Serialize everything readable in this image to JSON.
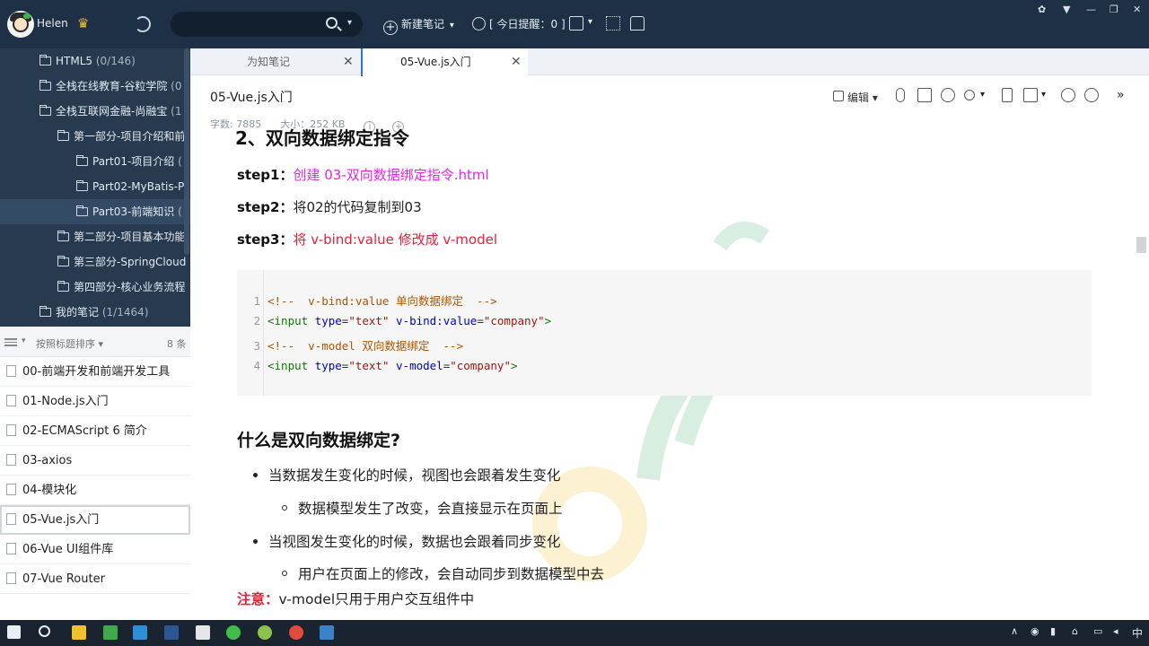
{
  "topbar": {
    "username": "Helen",
    "search_placeholder": "",
    "new_note": "新建笔记",
    "reminder": "[ 今日提醒：0 ]"
  },
  "folders": [
    {
      "name": "HTML5",
      "count": "(0/146)"
    },
    {
      "name": "全栈在线教育-谷粒学院",
      "count": "(0"
    },
    {
      "name": "全栈互联网金融-尚融宝",
      "count": "(1"
    },
    {
      "name": "第一部分-项目介绍和前",
      "count": ""
    },
    {
      "name": "Part01-项目介绍",
      "count": "("
    },
    {
      "name": "Part02-MyBatis-P",
      "count": ""
    },
    {
      "name": "Part03-前端知识",
      "count": "("
    },
    {
      "name": "第二部分-项目基本功能",
      "count": ""
    },
    {
      "name": "第三部分-SpringCloud",
      "count": ""
    },
    {
      "name": "第四部分-核心业务流程",
      "count": ""
    },
    {
      "name": "我的笔记",
      "count": "(1/1464)"
    }
  ],
  "sortbar": {
    "label": "按照标题排序",
    "count": "8 条"
  },
  "notes": [
    "00-前端开发和前端开发工具",
    "01-Node.js入门",
    "02-ECMAScript 6 简介",
    "03-axios",
    "04-模块化",
    "05-Vue.js入门",
    "06-Vue UI组件库",
    "07-Vue Router"
  ],
  "tabs": [
    {
      "label": "为知笔记"
    },
    {
      "label": "05-Vue.js入门"
    }
  ],
  "document": {
    "title": "05-Vue.js入门",
    "word_count": "字数: 7885",
    "size": "大小：252 KB",
    "edit_label": "编辑"
  },
  "content": {
    "heading_cut": "2、双向数据绑定指令",
    "steps": [
      {
        "label": "step1：",
        "text": "创建 03-双向数据绑定指令.html"
      },
      {
        "label": "step2：",
        "text": "将02的代码复制到03"
      },
      {
        "label": "step3：",
        "text": "将 v-bind:value 修改成 v-model"
      }
    ],
    "code": {
      "line_numbers": [
        "1",
        "2",
        "3",
        "4"
      ],
      "l1_comment": "<!--  v-bind:value 单向数据绑定  -->",
      "l2_tag": "<input",
      "l2_attr1": "type",
      "l2_val1": "\"text\"",
      "l2_attr2": "v-bind:value",
      "l2_val2": "\"company\"",
      "l2_end": ">",
      "l3_comment": "<!--  v-model 双向数据绑定  -->",
      "l4_tag": "<input",
      "l4_attr1": "type",
      "l4_val1": "\"text\"",
      "l4_attr2": "v-model",
      "l4_val2": "\"company\"",
      "l4_end": ">",
      "eq": "="
    },
    "section_heading": "什么是双向数据绑定?",
    "bullets": [
      "当数据发生变化的时候，视图也会跟着发生变化",
      "数据模型发生了改变，会直接显示在页面上",
      "当视图发生变化的时候，数据也会跟着同步变化",
      "用户在页面上的修改，会自动同步到数据模型中去"
    ],
    "note_label": "注意：",
    "note_text": "v-model只用于用户交互组件中"
  },
  "taskbar": {
    "ime": "中"
  },
  "colors": {
    "topbar_bg": "#1e3045",
    "sidebar_bg": "#273a4f",
    "accent_blue": "#2b78c5",
    "step_pink": "#e626e6",
    "step_red": "#e8203a"
  }
}
